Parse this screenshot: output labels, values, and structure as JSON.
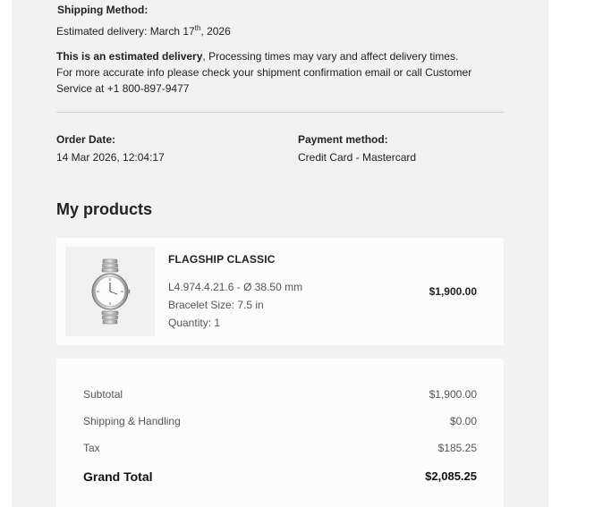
{
  "shipping": {
    "method_label": "Shipping Method:",
    "estimated_prefix": "Estimated delivery: March 17",
    "estimated_sup": "th",
    "estimated_suffix": ", 2026",
    "notice_bold": "This is an estimated delivery",
    "notice_rest": ", Processing times may vary and affect delivery times.",
    "notice_line2": "For more accurate info please check your shipment confirmation email or call Customer",
    "notice_line3": "Service at +1 800-897-9477"
  },
  "order": {
    "date_label": "Order Date:",
    "date_value": "14 Mar 2026, 12:04:17",
    "payment_label": "Payment method:",
    "payment_value": "Credit Card - Mastercard"
  },
  "products_heading": "My products",
  "product": {
    "name": "FLAGSHIP CLASSIC",
    "reference": "L4.974.4.21.6 - Ø 38.50 mm",
    "bracelet": "Bracelet Size:  7.5 in",
    "quantity": "Quantity: 1",
    "price": "$1,900.00",
    "image_icon": "watch-image"
  },
  "summary": {
    "subtotal_label": "Subtotal",
    "subtotal_value": "$1,900.00",
    "shipping_label": "Shipping & Handling",
    "shipping_value": "$0.00",
    "tax_label": "Tax",
    "tax_value": "$185.25",
    "grand_label": "Grand Total",
    "grand_value": "$2,085.25"
  }
}
